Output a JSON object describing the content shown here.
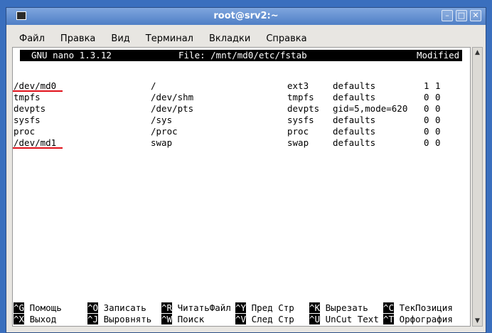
{
  "window": {
    "title": "root@srv2:~"
  },
  "menu": [
    {
      "label": "Файл"
    },
    {
      "label": "Правка"
    },
    {
      "label": "Вид"
    },
    {
      "label": "Терминал"
    },
    {
      "label": "Вкладки"
    },
    {
      "label": "Справка"
    }
  ],
  "nano": {
    "version": "GNU nano 1.3.12",
    "file": "File: /mnt/md0/etc/fstab",
    "status": "Modified"
  },
  "fstab": [
    {
      "device": "/dev/md0",
      "mount": "/",
      "type": "ext3",
      "options": "defaults",
      "dump": "1",
      "pass": "1",
      "highlight": true
    },
    {
      "device": "tmpfs",
      "mount": "/dev/shm",
      "type": "tmpfs",
      "options": "defaults",
      "dump": "0",
      "pass": "0",
      "highlight": false
    },
    {
      "device": "devpts",
      "mount": "/dev/pts",
      "type": "devpts",
      "options": "gid=5,mode=620",
      "dump": "0",
      "pass": "0",
      "highlight": false
    },
    {
      "device": "sysfs",
      "mount": "/sys",
      "type": "sysfs",
      "options": "defaults",
      "dump": "0",
      "pass": "0",
      "highlight": false
    },
    {
      "device": "proc",
      "mount": "/proc",
      "type": "proc",
      "options": "defaults",
      "dump": "0",
      "pass": "0",
      "highlight": false
    },
    {
      "device": "/dev/md1",
      "mount": "swap",
      "type": "swap",
      "options": "defaults",
      "dump": "0",
      "pass": "0",
      "highlight": true
    }
  ],
  "shortcuts": [
    [
      {
        "key": "^G",
        "label": "Помощь"
      },
      {
        "key": "^O",
        "label": "Записать"
      },
      {
        "key": "^R",
        "label": "ЧитатьФайл"
      },
      {
        "key": "^Y",
        "label": "Пред Стр"
      },
      {
        "key": "^K",
        "label": "Вырезать"
      },
      {
        "key": "^C",
        "label": "ТекПозиция"
      }
    ],
    [
      {
        "key": "^X",
        "label": "Выход"
      },
      {
        "key": "^J",
        "label": "Выровнять"
      },
      {
        "key": "^W",
        "label": "Поиск"
      },
      {
        "key": "^V",
        "label": "След Стр"
      },
      {
        "key": "^U",
        "label": "UnCut Text"
      },
      {
        "key": "^T",
        "label": "Орфография"
      }
    ]
  ],
  "colors": {
    "highlight_underline": "#e0101a",
    "desktop": "#3a6fbe"
  }
}
